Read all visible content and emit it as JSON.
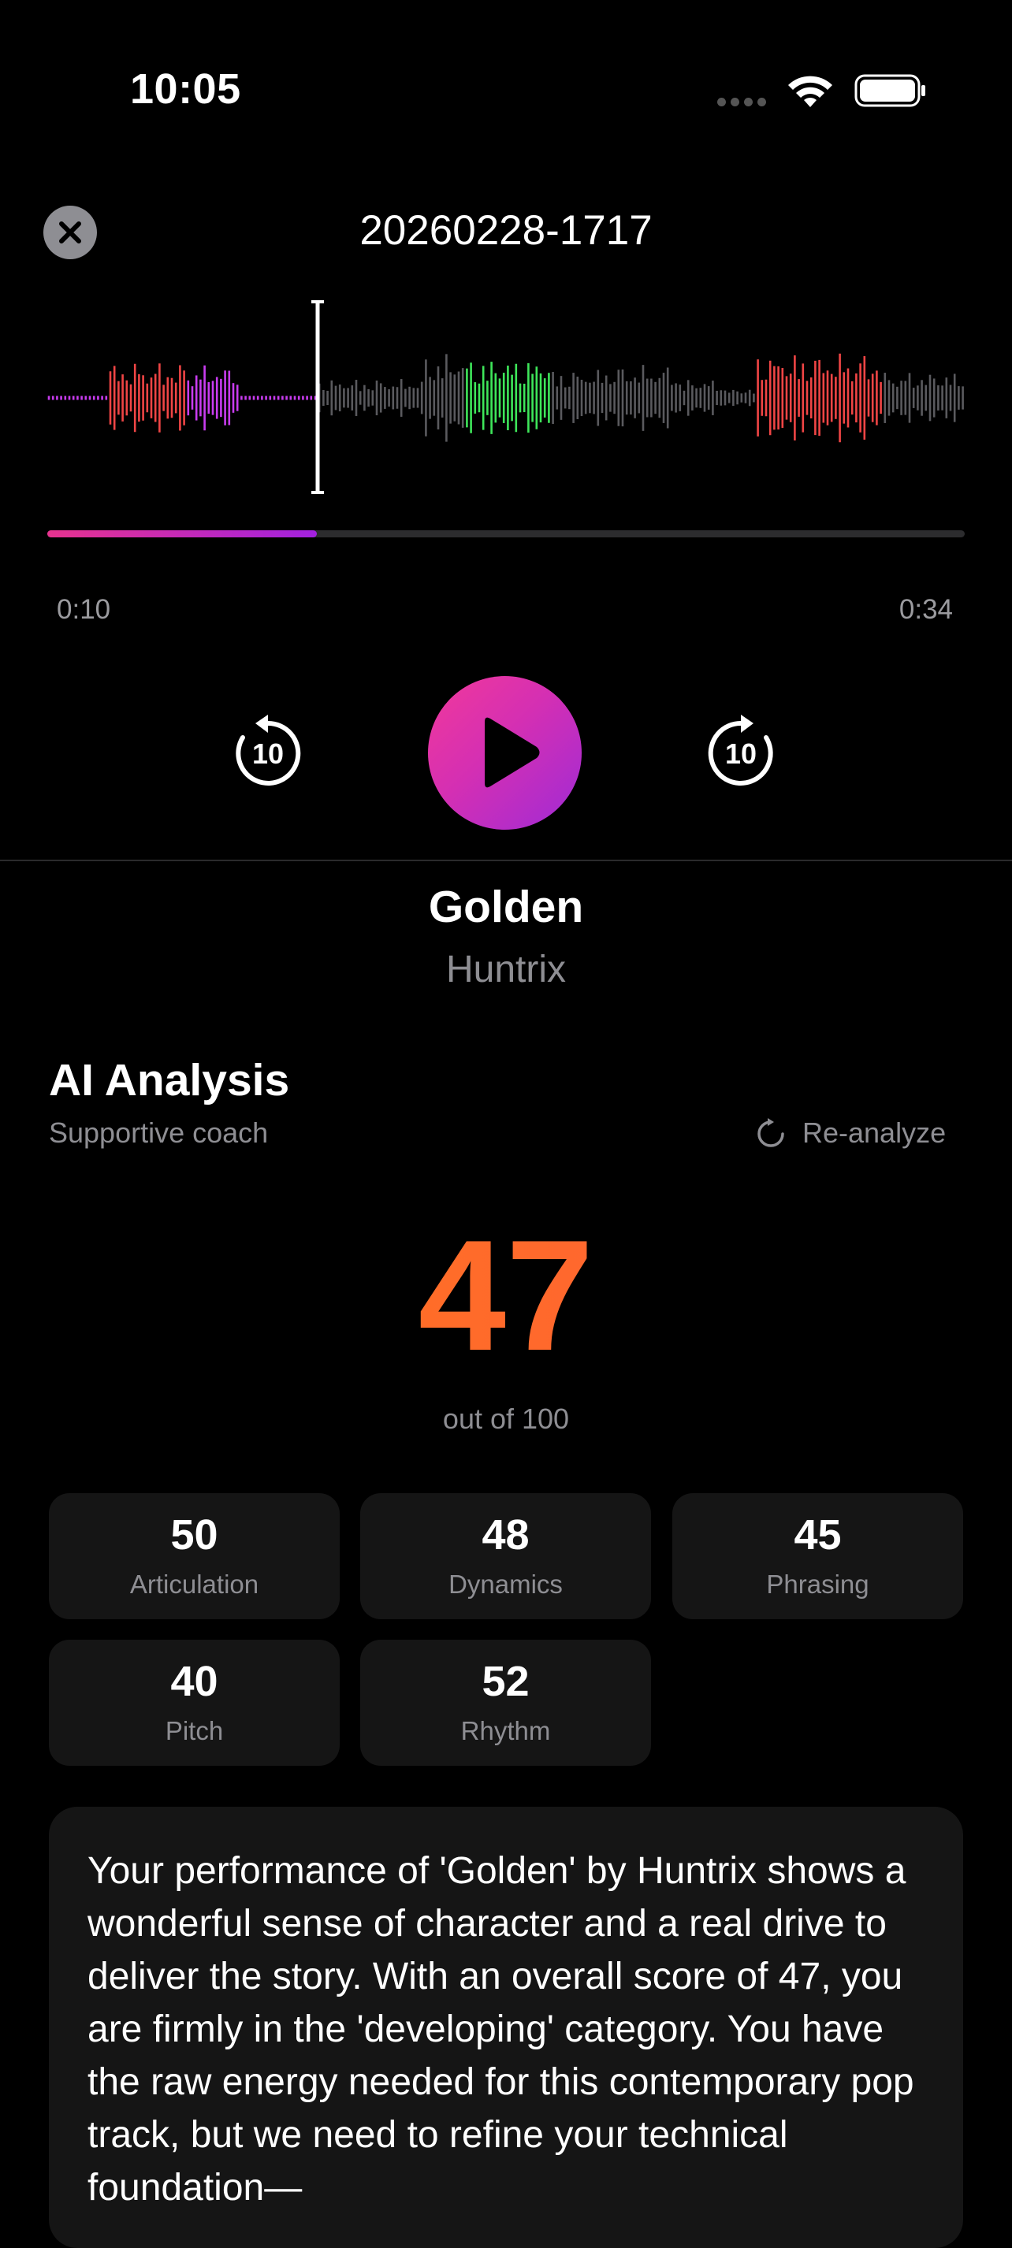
{
  "status_bar": {
    "time": "10:05"
  },
  "recording": {
    "title": "20260228-1717",
    "elapsed": "0:10",
    "duration": "0:34",
    "progress_fraction": 0.294
  },
  "song": {
    "title": "Golden",
    "artist": "Huntrix"
  },
  "analysis": {
    "title": "AI Analysis",
    "subtitle": "Supportive coach",
    "reanalyze_label": "Re-analyze",
    "score": "47",
    "score_caption": "out of 100",
    "metrics": [
      {
        "value": "50",
        "label": "Articulation"
      },
      {
        "value": "48",
        "label": "Dynamics"
      },
      {
        "value": "45",
        "label": "Phrasing"
      },
      {
        "value": "40",
        "label": "Pitch"
      },
      {
        "value": "52",
        "label": "Rhythm"
      }
    ],
    "feedback": "Your performance of 'Golden' by Huntrix shows a wonderful sense of character and a real drive to deliver the story. With an overall score of 47, you are firmly in the 'developing' category. You have the raw energy needed for this contemporary pop track, but we need to refine your technical foundation—"
  },
  "colors": {
    "accent_pink": "#e8338f",
    "accent_purple": "#a321e0",
    "score_orange": "#ff7a1a",
    "wave_red": "#f04545",
    "wave_green": "#3ee65a",
    "wave_gray": "#5a5a5e",
    "wave_magenta": "#c93cf0"
  },
  "icons": {
    "close": "close-icon",
    "play": "play-icon",
    "skip_back": "rewind-10-icon",
    "skip_forward": "forward-10-icon",
    "reanalyze": "refresh-icon",
    "wifi": "wifi-icon",
    "battery": "battery-icon",
    "signal": "cellular-signal-icon"
  }
}
